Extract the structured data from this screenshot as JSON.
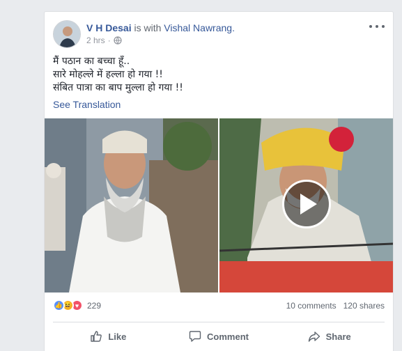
{
  "post": {
    "author": "V H Desai",
    "with_text": "is with",
    "tagged": "Vishal Nawrang.",
    "time": "2 hrs",
    "privacy_icon": "globe-icon",
    "lines": [
      "मैं पठान का बच्चा हूँ..",
      "सारे मोहल्ले में हल्ला हो गया !!",
      "संबित पात्रा का बाप मुल्ला हो गया !!"
    ],
    "see_translation": "See Translation"
  },
  "media": {
    "left_icon": "photo",
    "right_icon": "play-icon"
  },
  "stats": {
    "reaction_icons": [
      "like-icon",
      "haha-icon",
      "love-icon"
    ],
    "reactions_count": "229",
    "comments": "10 comments",
    "shares": "120 shares"
  },
  "actions": {
    "like": "Like",
    "comment": "Comment",
    "share": "Share"
  },
  "colors": {
    "link": "#365899",
    "reaction_like": "#5890ff",
    "reaction_haha": "#f7b125",
    "reaction_love": "#f25268"
  }
}
